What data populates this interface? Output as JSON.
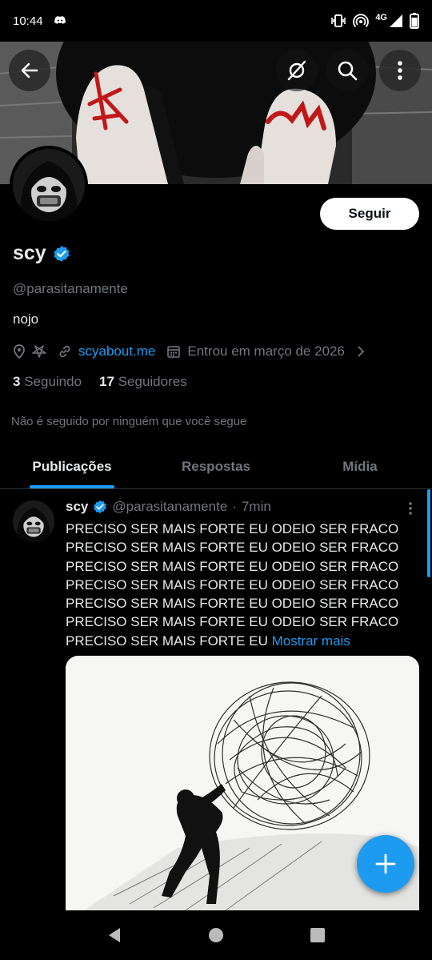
{
  "status_bar": {
    "time": "10:44",
    "network": "4G",
    "icons": [
      "discord-icon",
      "vibrate-icon",
      "hotspot-icon",
      "signal-icon",
      "battery-icon"
    ]
  },
  "profile": {
    "display_name": "scy",
    "verified": true,
    "handle": "@parasitanamente",
    "bio": "nojo",
    "website": "scyabout.me",
    "joined": "Entrou em março de 2026",
    "following_count": "3",
    "following_label": "Seguindo",
    "followers_count": "17",
    "followers_label": "Seguidores",
    "not_followed_text": "Não é seguido por ninguém que você segue",
    "follow_button": "Seguir"
  },
  "tabs": [
    {
      "label": "Publicações",
      "active": true
    },
    {
      "label": "Respostas",
      "active": false
    },
    {
      "label": "Mídia",
      "active": false
    }
  ],
  "post": {
    "name": "scy",
    "handle": "@parasitanamente",
    "separator": "·",
    "time": "7min",
    "lines": [
      "PRECISO SER MAIS FORTE EU ODEIO SER FRACO",
      "PRECISO SER MAIS FORTE EU ODEIO SER FRACO",
      "PRECISO SER MAIS FORTE EU ODEIO SER FRACO",
      "PRECISO SER MAIS FORTE EU ODEIO SER FRACO",
      "PRECISO SER MAIS FORTE EU ODEIO SER FRACO",
      "PRECISO SER MAIS FORTE EU ODEIO SER FRACO"
    ],
    "last_line": "PRECISO SER MAIS FORTE EU ",
    "show_more": "Mostrar mais"
  },
  "colors": {
    "accent": "#1d9bf0",
    "background": "#000000",
    "text": "#e7e9ea",
    "muted": "#71767b"
  }
}
